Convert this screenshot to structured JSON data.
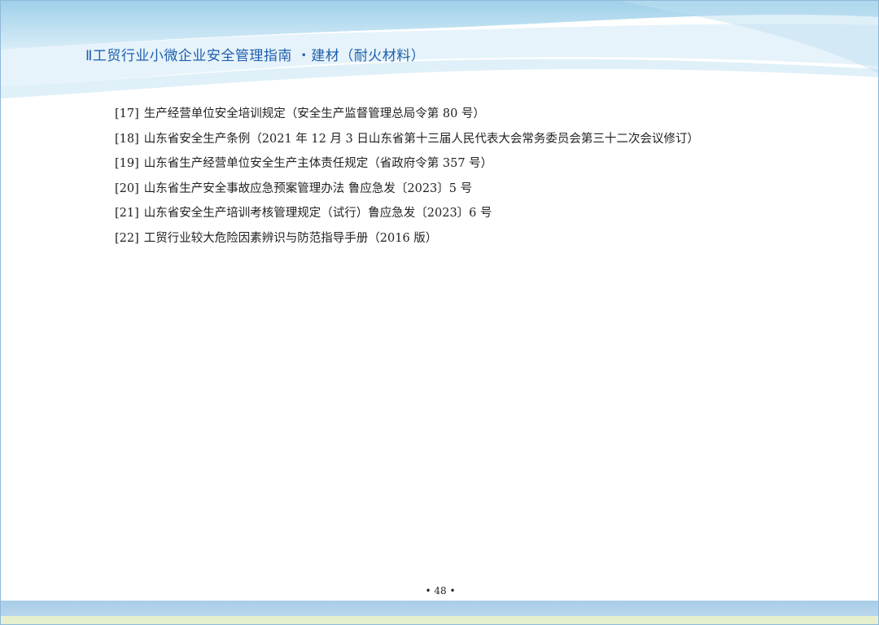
{
  "header": {
    "title": "Ⅱ工贸行业小微企业安全管理指南 ・建材（耐火材料）"
  },
  "references": [
    {
      "num": "[17]",
      "text": "生产经营单位安全培训规定（安全生产监督管理总局令第 80 号）"
    },
    {
      "num": "[18]",
      "text": "山东省安全生产条例（2021 年 12 月 3 日山东省第十三届人民代表大会常务委员会第三十二次会议修订）"
    },
    {
      "num": "[19]",
      "text": "山东省生产经营单位安全生产主体责任规定（省政府令第 357 号）"
    },
    {
      "num": "[20]",
      "text": "山东省生产安全事故应急预案管理办法 鲁应急发〔2023〕5 号"
    },
    {
      "num": "[21]",
      "text": "山东省安全生产培训考核管理规定（试行）鲁应急发〔2023〕6 号"
    },
    {
      "num": "[22]",
      "text": "工贸行业较大危险因素辨识与防范指导手册（2016 版）"
    }
  ],
  "footer": {
    "page_number": "• 48 •"
  },
  "colors": {
    "title": "#1f5fae",
    "wave_light": "#e3f1f8",
    "wave_mid": "#b9dcef",
    "footer_band": "#b8d6ec",
    "footer_line": "#e6f0cf"
  }
}
